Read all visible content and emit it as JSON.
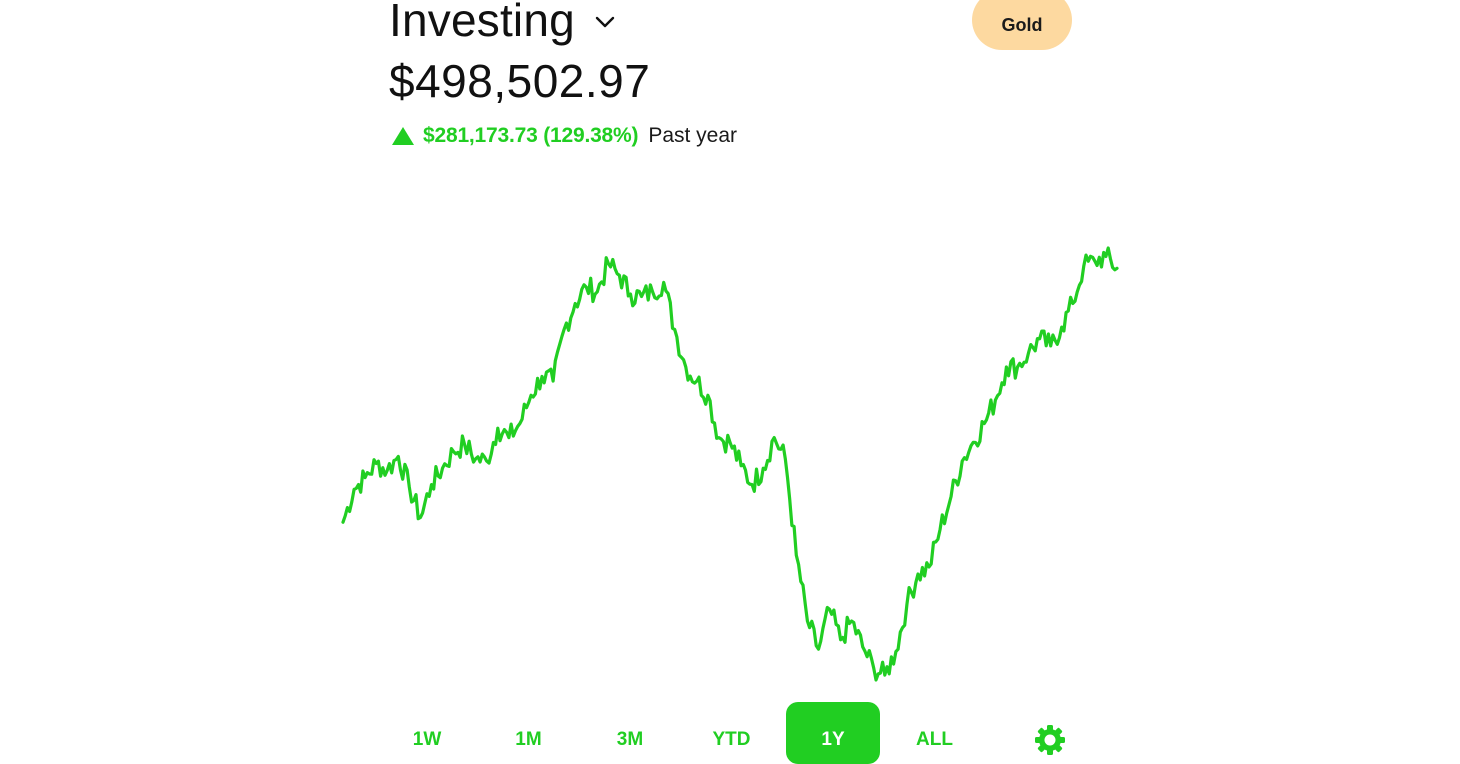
{
  "header": {
    "title": "Investing",
    "gold_label": "Gold"
  },
  "portfolio": {
    "value": "$498,502.97",
    "change": "$281,173.73 (129.38%)",
    "period": "Past year"
  },
  "colors": {
    "accent": "#21ce22",
    "gold_bg": "#fdd9a0",
    "text": "#111111",
    "background": "#ffffff"
  },
  "range_tabs": [
    {
      "label": "1W",
      "active": false
    },
    {
      "label": "1M",
      "active": false
    },
    {
      "label": "3M",
      "active": false
    },
    {
      "label": "YTD",
      "active": false
    },
    {
      "label": "1Y",
      "active": true
    },
    {
      "label": "ALL",
      "active": false
    }
  ],
  "icons": {
    "dropdown": "chevron-down-icon",
    "change": "triangle-up-icon",
    "settings": "gear-icon"
  },
  "chart_data": {
    "type": "line",
    "series": [
      {
        "values": [
          240,
          254,
          259,
          265,
          262,
          268,
          255,
          242,
          256,
          263,
          270,
          273,
          267,
          266,
          280,
          276,
          282,
          294,
          302,
          300,
          322,
          333,
          340,
          338,
          350,
          345,
          337,
          336,
          338,
          342,
          322,
          306,
          300,
          294,
          276,
          274,
          264,
          256,
          263,
          276,
          267,
          226,
          198,
          186,
          203,
          190,
          198,
          187,
          178,
          175,
          185,
          205,
          218,
          221,
          237,
          251,
          266,
          274,
          282,
          292,
          306,
          306,
          312,
          318,
          315,
          323,
          333,
          349,
          351,
          353,
          348
        ]
      }
    ]
  }
}
